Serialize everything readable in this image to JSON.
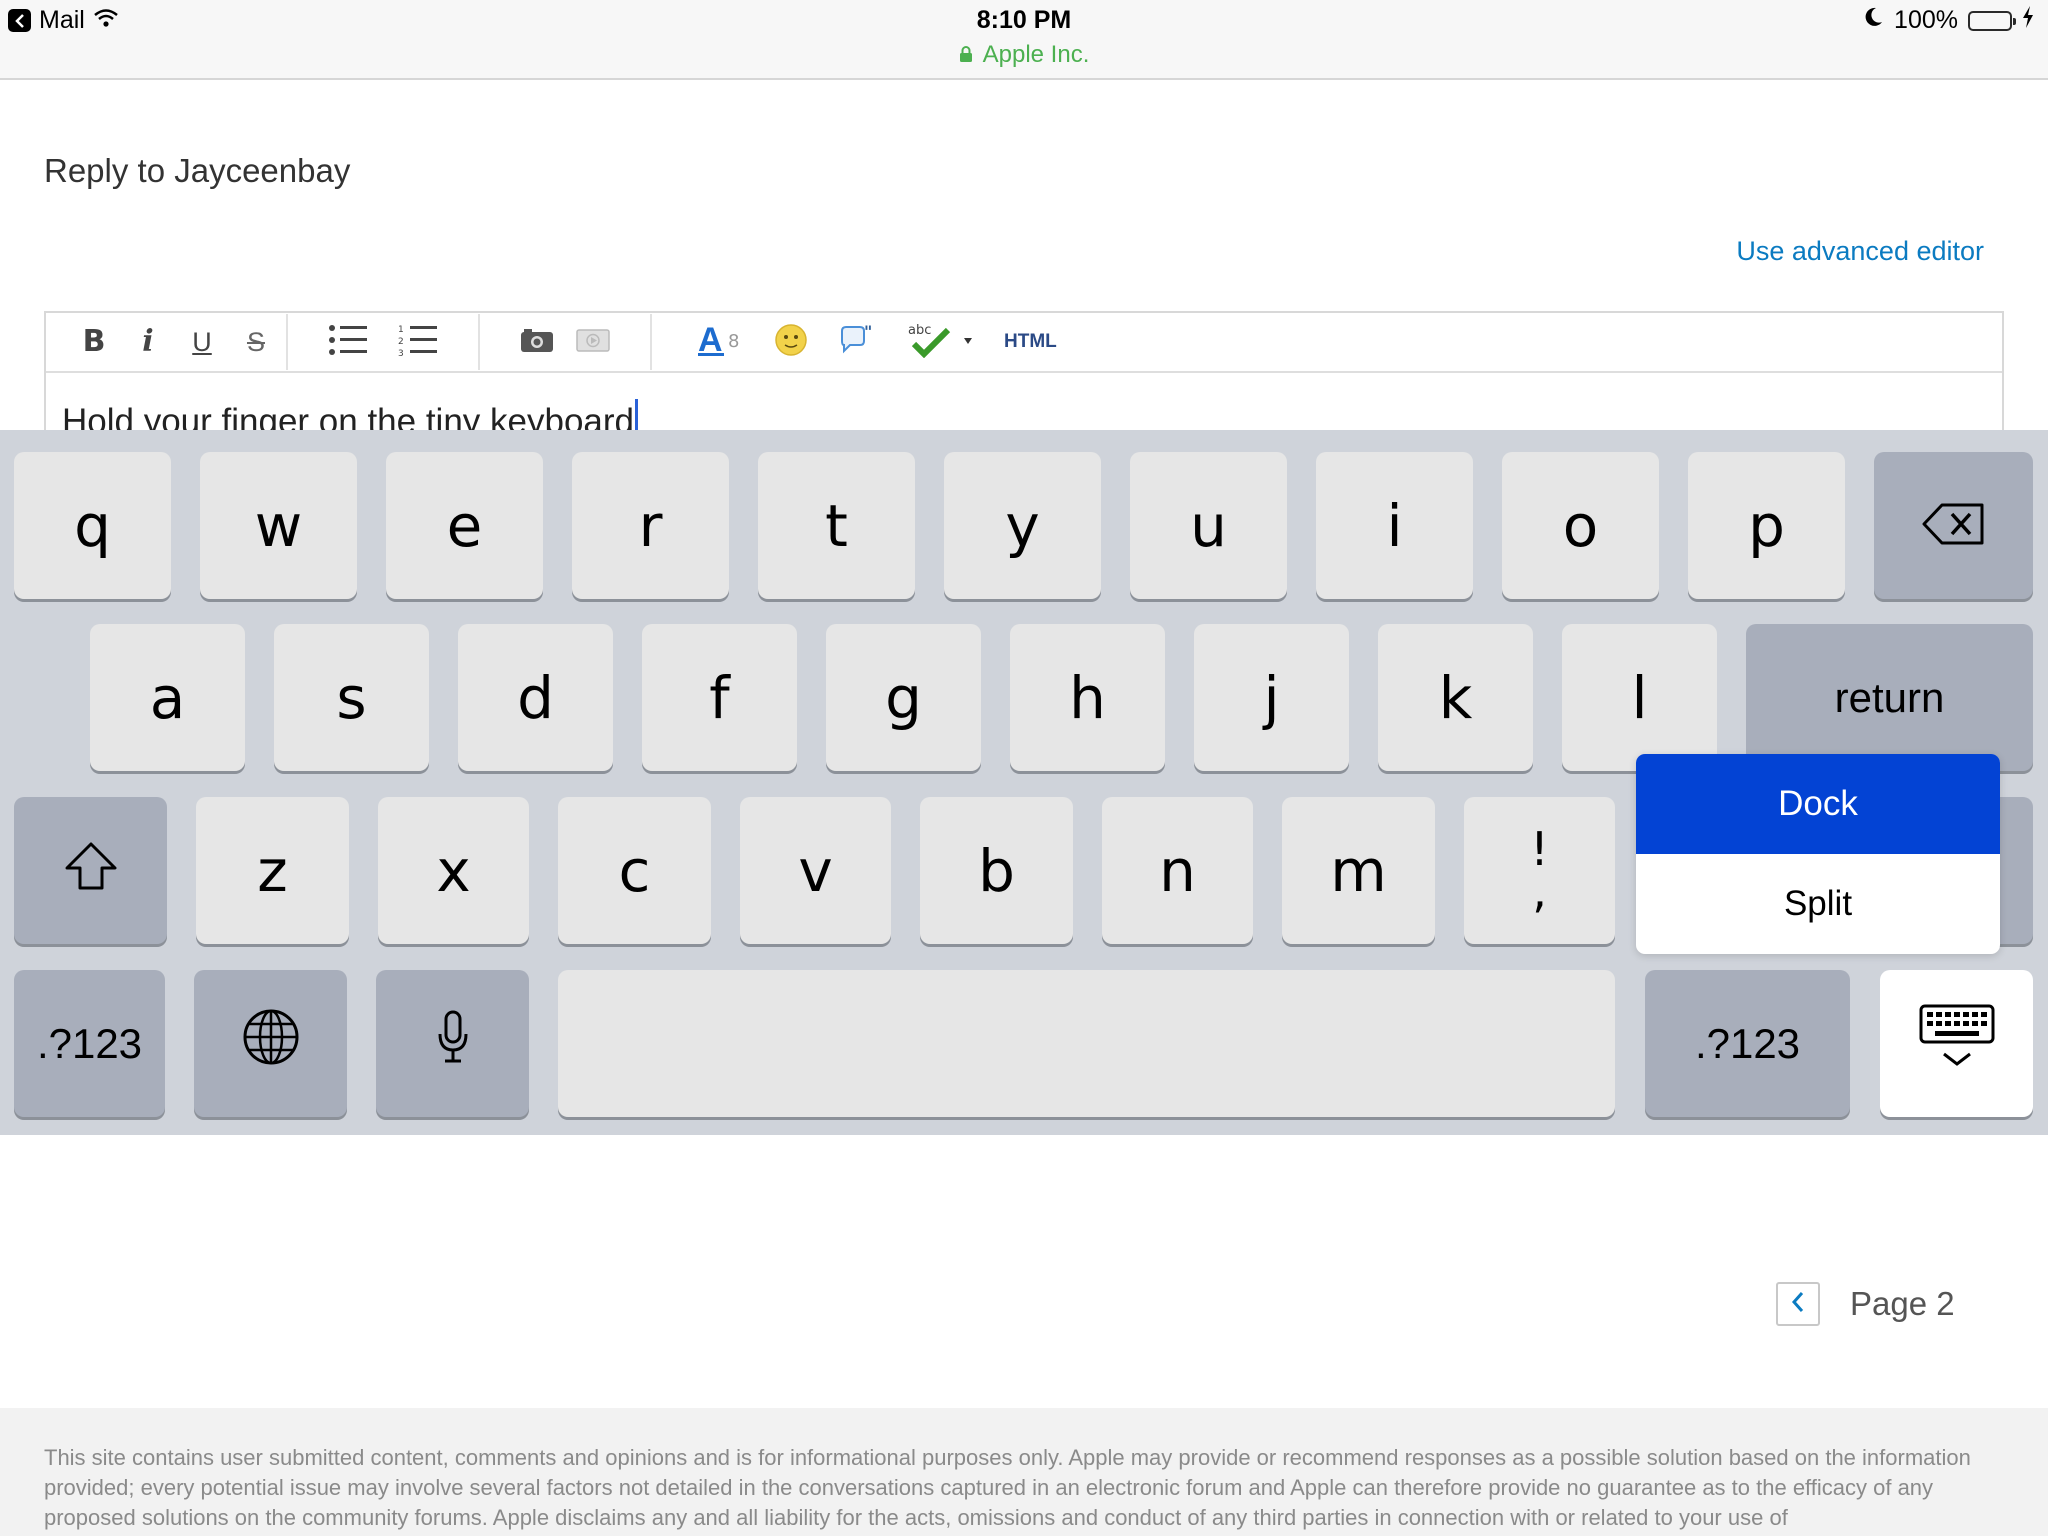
{
  "status_bar": {
    "back_app": "Mail",
    "time": "8:10 PM",
    "site": "Apple Inc.",
    "battery": "100%",
    "battery_level": 1.0
  },
  "content": {
    "reply_title": "Reply to Jayceenbay",
    "advanced_link": "Use advanced editor",
    "toolbar": {
      "bold": "B",
      "italic": "i",
      "underline": "U",
      "strike": "S",
      "html": "HTML"
    },
    "editor_text": "Hold your finger on the tiny keyboard"
  },
  "keyboard": {
    "row1": [
      "q",
      "w",
      "e",
      "r",
      "t",
      "y",
      "u",
      "i",
      "o",
      "p"
    ],
    "row2": [
      "a",
      "s",
      "d",
      "f",
      "g",
      "h",
      "j",
      "k",
      "l"
    ],
    "row3": [
      "z",
      "x",
      "c",
      "v",
      "b",
      "n",
      "m"
    ],
    "punct_top": "!",
    "punct_bottom": ",",
    "return": "return",
    "numbers_left": ".?123",
    "numbers_right": ".?123",
    "popup": {
      "dock": "Dock",
      "split": "Split"
    }
  },
  "pager": {
    "label": "Page 2"
  },
  "footer": {
    "text": "This site contains user submitted content, comments and opinions and is for informational purposes only. Apple may provide or recommend responses as a possible solution based on the information provided; every potential issue may involve several factors not detailed in the conversations captured in an electronic forum and Apple can therefore provide no guarantee as to the efficacy of any proposed solutions on the community forums. Apple disclaims any and all liability for the acts, omissions and conduct of any third parties in connection with or related to your use of"
  },
  "colors": {
    "link": "#0b7bc1",
    "secure": "#4cb050",
    "popup_active": "#0343d4",
    "keyboard_bg": "#cfd3da"
  }
}
